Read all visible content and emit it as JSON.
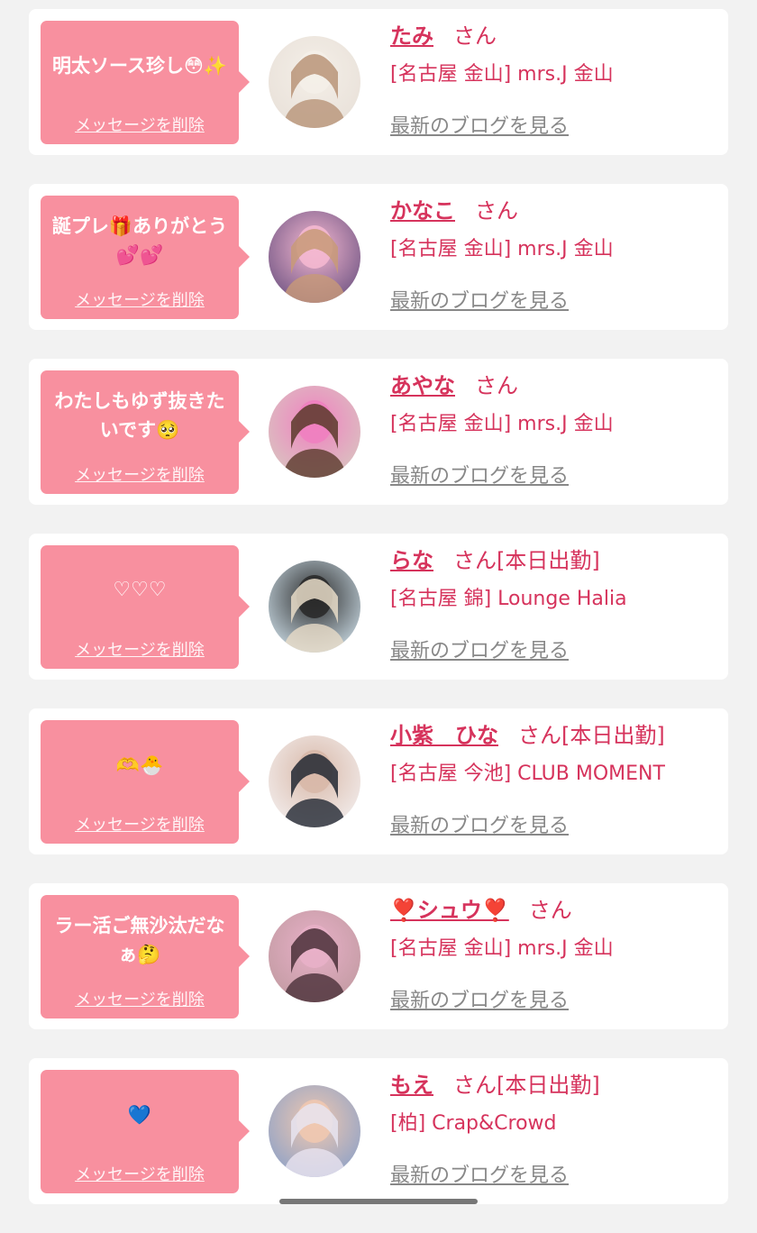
{
  "messages": [
    {
      "text": "明太ソース珍し😳✨",
      "delete_label": "メッセージを削除",
      "name": "たみ",
      "suffix": "さん",
      "shop": "[名古屋 金山] mrs.J 金山",
      "blog_label": "最新のブログを見る",
      "avatar_colors": [
        "#e8e0d8",
        "#b89478",
        "#f4efe8"
      ]
    },
    {
      "text": "誕プレ🎁ありがとう💕💕",
      "delete_label": "メッセージを削除",
      "name": "かなこ",
      "suffix": "さん",
      "shop": "[名古屋 金山] mrs.J 金山",
      "blog_label": "最新のブログを見る",
      "avatar_colors": [
        "#6a5080",
        "#c89a78",
        "#f4b8d0"
      ]
    },
    {
      "text": "わたしもゆず抜きたいです🥺",
      "delete_label": "メッセージを削除",
      "name": "あやな",
      "suffix": "さん",
      "shop": "[名古屋 金山] mrs.J 金山",
      "blog_label": "最新のブログを見る",
      "avatar_colors": [
        "#d8c8c0",
        "#5a3a2a",
        "#f080c0"
      ]
    },
    {
      "text": "♡♡♡",
      "delete_label": "メッセージを削除",
      "name": "らな",
      "suffix": "さん[本日出勤]",
      "shop": "[名古屋 錦] Lounge Halia",
      "blog_label": "最新のブログを見る",
      "avatar_colors": [
        "#cfe0ea",
        "#e8dcc8",
        "#2a2a2a"
      ]
    },
    {
      "text": "🫶🐣",
      "delete_label": "メッセージを削除",
      "name": "小紫　ひな",
      "suffix": "さん[本日出勤]",
      "shop": "[名古屋 今池] CLUB MOMENT",
      "blog_label": "最新のブログを見る",
      "avatar_colors": [
        "#f4f0f0",
        "#222833",
        "#d8b8a8"
      ]
    },
    {
      "text": "ラー活ご無沙汰だなぁ🤔",
      "delete_label": "メッセージを削除",
      "name": "❣️シュウ❣️",
      "suffix": "さん",
      "shop": "[名古屋 金山] mrs.J 金山",
      "blog_label": "最新のブログを見る",
      "avatar_colors": [
        "#c09aa0",
        "#4a3038",
        "#e8b0c8"
      ]
    },
    {
      "text": "💙",
      "delete_label": "メッセージを削除",
      "name": "もえ",
      "suffix": "さん[本日出勤]",
      "shop": "[柏] Crap&Crowd",
      "blog_label": "最新のブログを見る",
      "avatar_colors": [
        "#8aa0c8",
        "#e8e4f0",
        "#f0c8b0"
      ]
    }
  ],
  "colors": {
    "accent": "#d6335c",
    "bubble": "#f8909f",
    "link_gray": "#888888",
    "background": "#f2f2f2"
  }
}
